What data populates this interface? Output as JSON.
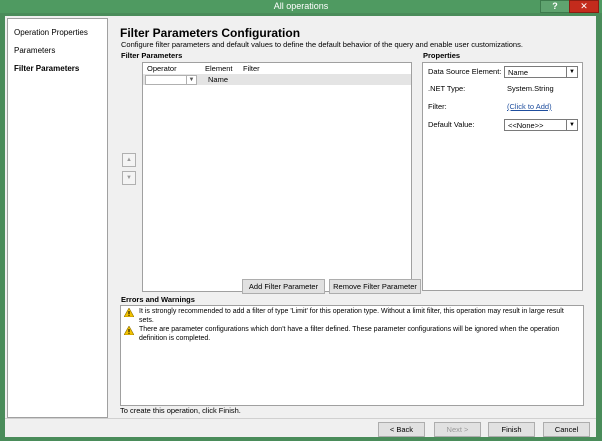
{
  "window": {
    "title": "All operations",
    "help_label": "?",
    "close_label": "✕"
  },
  "nav": {
    "items": [
      {
        "label": "Operation Properties"
      },
      {
        "label": "Parameters"
      },
      {
        "label": "Filter Parameters"
      }
    ]
  },
  "main": {
    "title": "Filter Parameters Configuration",
    "description": "Configure filter parameters and default values to define the default behavior of the query and enable user customizations.",
    "filter_params_label": "Filter Parameters",
    "columns": [
      "Operator",
      "Element",
      "Filter"
    ],
    "rows": [
      {
        "operator": "",
        "element": "Name",
        "filter": ""
      }
    ],
    "move_up_icon": "▲",
    "move_down_icon": "▼",
    "add_button": "Add Filter Parameter",
    "remove_button": "Remove Filter Parameter"
  },
  "properties": {
    "label": "Properties",
    "data_source_label": "Data Source Element:",
    "data_source_value": "Name",
    "net_type_label": ".NET Type:",
    "net_type_value": "System.String",
    "filter_label": "Filter:",
    "filter_value": "(Click to Add)",
    "default_label": "Default Value:",
    "default_value": "<<None>>"
  },
  "errors": {
    "label": "Errors and Warnings",
    "messages": [
      "It is strongly recommended to add a filter of type 'Limit' for this operation type. Without a limit filter, this operation may result in large result sets.",
      "There are parameter configurations which don't have a filter defined. These parameter configurations will be ignored when the operation definition is completed."
    ]
  },
  "footer": {
    "hint": "To create this operation, click Finish.",
    "back": "< Back",
    "next": "Next >",
    "finish": "Finish",
    "cancel": "Cancel"
  },
  "colors": {
    "title_bar": "#4f9a61",
    "close": "#c42b1c",
    "link": "#1f4e9e",
    "warning": "#f2c200"
  }
}
